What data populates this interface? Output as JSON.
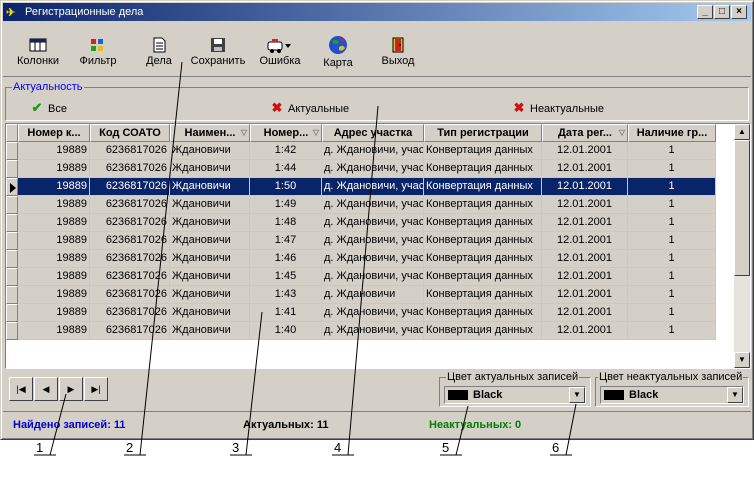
{
  "window": {
    "title": "Регистрационные дела",
    "controls": [
      "_",
      "□",
      "×"
    ]
  },
  "toolbar": [
    {
      "label": "Колонки",
      "icon": "columns-icon"
    },
    {
      "label": "Фильтр",
      "icon": "filter-icon"
    },
    {
      "label": "Дела",
      "icon": "document-icon"
    },
    {
      "label": "Сохранить",
      "icon": "save-icon"
    },
    {
      "label": "Ошибка",
      "icon": "error-report-icon"
    },
    {
      "label": "Карта",
      "icon": "globe-map-icon"
    },
    {
      "label": "Выход",
      "icon": "exit-door-icon"
    }
  ],
  "filter": {
    "title": "Актуальность",
    "all": "Все",
    "actual": "Актуальные",
    "nonactual": "Неактуальные"
  },
  "grid": {
    "columns": [
      "Номер к...",
      "Код СОАТО",
      "Наимен...",
      "Номер...",
      "Адрес участка",
      "Тип регистрации",
      "Дата рег...",
      "Наличие гр..."
    ],
    "selected_row": 2,
    "rows": [
      [
        "19889",
        "6236817026",
        "Ждановичи",
        "1:42",
        "д. Ждановичи, участ",
        "Конвертация данных",
        "12.01.2001",
        "1"
      ],
      [
        "19889",
        "6236817026",
        "Ждановичи",
        "1:44",
        "д. Ждановичи, участ",
        "Конвертация данных",
        "12.01.2001",
        "1"
      ],
      [
        "19889",
        "6236817026",
        "Ждановичи",
        "1:50",
        "д. Ждановичи, участ",
        "Конвертация данных",
        "12.01.2001",
        "1"
      ],
      [
        "19889",
        "6236817026",
        "Ждановичи",
        "1:49",
        "д. Ждановичи, участ",
        "Конвертация данных",
        "12.01.2001",
        "1"
      ],
      [
        "19889",
        "6236817026",
        "Ждановичи",
        "1:48",
        "д. Ждановичи, участ",
        "Конвертация данных",
        "12.01.2001",
        "1"
      ],
      [
        "19889",
        "6236817026",
        "Ждановичи",
        "1:47",
        "д. Ждановичи, участ",
        "Конвертация данных",
        "12.01.2001",
        "1"
      ],
      [
        "19889",
        "6236817026",
        "Ждановичи",
        "1:46",
        "д. Ждановичи, участ",
        "Конвертация данных",
        "12.01.2001",
        "1"
      ],
      [
        "19889",
        "6236817026",
        "Ждановичи",
        "1:45",
        "д. Ждановичи, участ",
        "Конвертация данных",
        "12.01.2001",
        "1"
      ],
      [
        "19889",
        "6236817026",
        "Ждановичи",
        "1:43",
        "д. Ждановичи",
        "Конвертация данных",
        "12.01.2001",
        "1"
      ],
      [
        "19889",
        "6236817026",
        "Ждановичи",
        "1:41",
        "д. Ждановичи, участ",
        "Конвертация данных",
        "12.01.2001",
        "1"
      ],
      [
        "19889",
        "6236817026",
        "Ждановичи",
        "1:40",
        "д. Ждановичи, участ",
        "Конвертация данных",
        "12.01.2001",
        "1"
      ]
    ]
  },
  "navigator": [
    "|◀",
    "◀",
    "▶",
    "▶|"
  ],
  "colors": {
    "actual_caption": "Цвет актуальных записей",
    "actual_value": "Black",
    "nonactual_caption": "Цвет неактуальных записей",
    "nonactual_value": "Black"
  },
  "status": {
    "found": "Найдено записей: 11",
    "actual": "Актуальных: 11",
    "nonactual": "Неактуальных: 0",
    "found_color": "#0000cc",
    "nonactual_color": "#008000"
  },
  "callouts": [
    "1",
    "2",
    "3",
    "4",
    "5",
    "6"
  ]
}
